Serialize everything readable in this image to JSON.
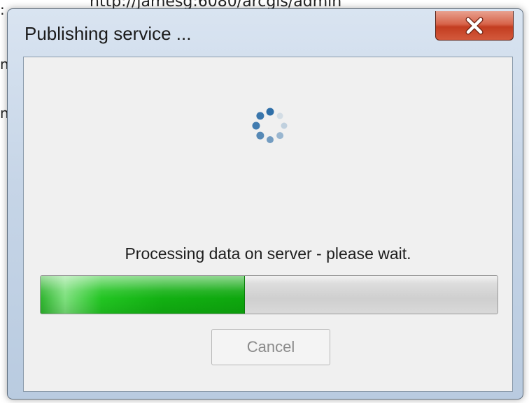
{
  "background": {
    "url_fragment": "http://jamesg:6080/arcgis/admin",
    "fragments": [
      ":",
      "n",
      "n"
    ]
  },
  "dialog": {
    "title": "Publishing service ...",
    "message": "Processing data on server - please wait.",
    "progress_percent": 44.5,
    "cancel_label": "Cancel",
    "cancel_enabled": false
  },
  "icons": {
    "close": "close-icon",
    "spinner": "loading-spinner-icon"
  },
  "colors": {
    "progress_fill": "#14b014",
    "spinner_dot": "#2f6fa8",
    "close_button": "#c9452a"
  }
}
